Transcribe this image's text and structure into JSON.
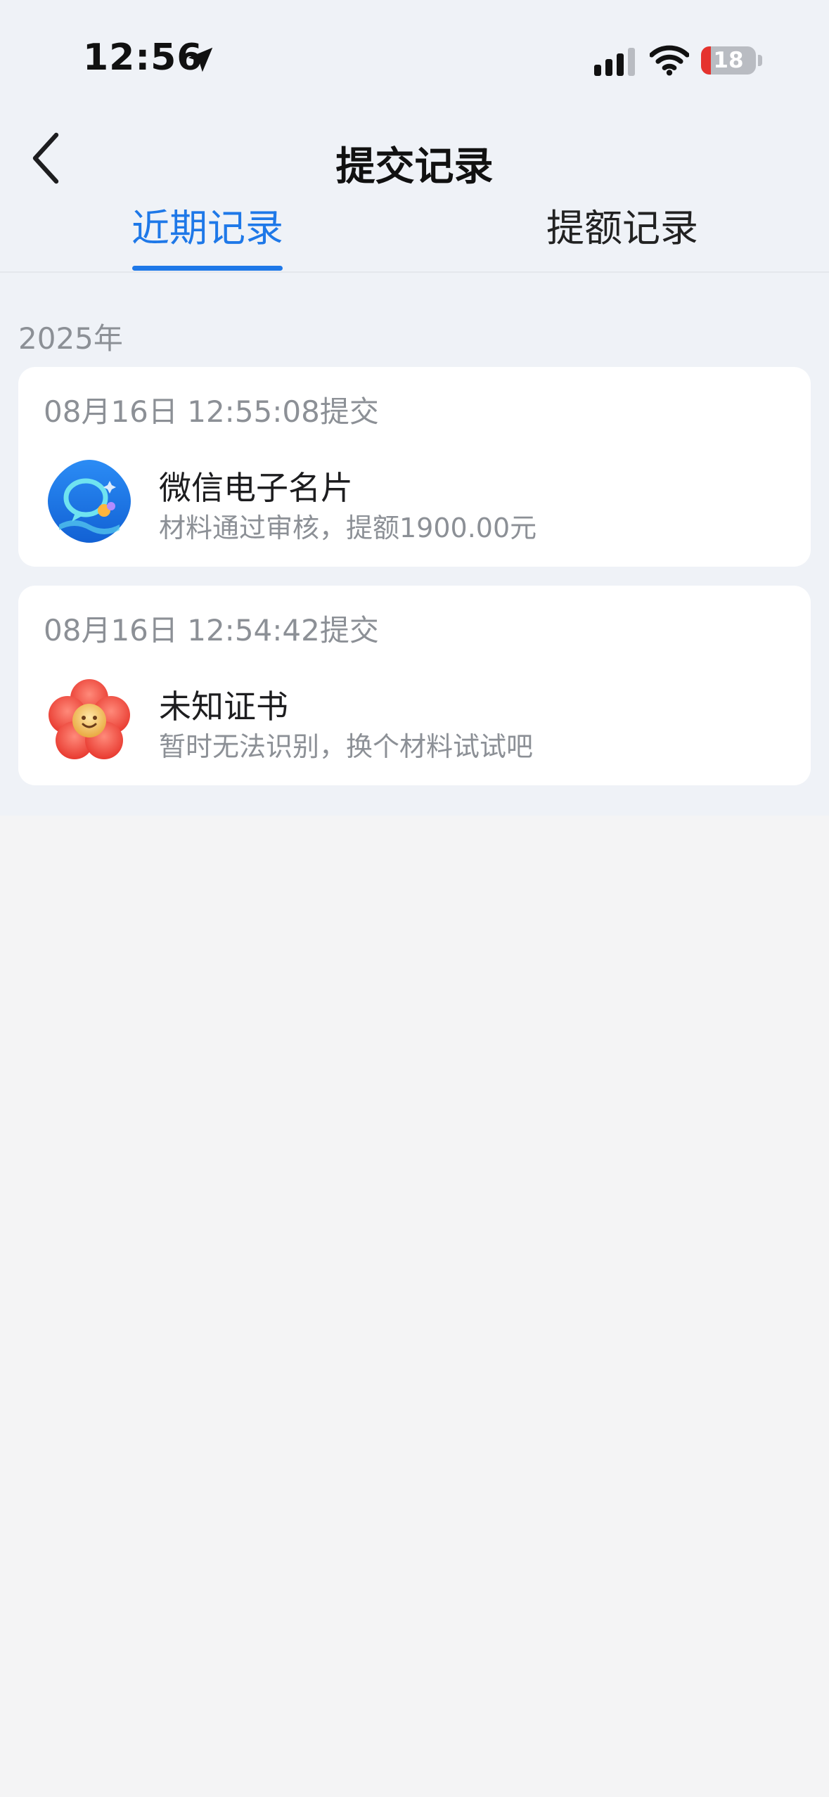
{
  "status_bar": {
    "time": "12:56",
    "battery_level": "18",
    "icons": [
      "location-arrow-icon",
      "cellular-signal-icon",
      "wifi-icon",
      "battery-icon"
    ]
  },
  "nav": {
    "title": "提交记录",
    "back_icon": "chevron-left-icon"
  },
  "tabs": [
    {
      "label": "近期记录",
      "active": true
    },
    {
      "label": "提额记录",
      "active": false
    }
  ],
  "colors": {
    "accent": "#1e78e8",
    "battery_low": "#e5332e",
    "top_background": "#eff2f7",
    "page_background": "#f4f4f5"
  },
  "records": {
    "year": "2025年",
    "items": [
      {
        "time": "08月16日 12:55:08提交",
        "title": "微信电子名片",
        "desc": "材料通过审核，提额1900.00元",
        "icon": "wechat-card-app-icon"
      },
      {
        "time": "08月16日 12:54:42提交",
        "title": "未知证书",
        "desc": "暂时无法识别，换个材料试试吧",
        "icon": "red-flower-icon"
      }
    ]
  }
}
